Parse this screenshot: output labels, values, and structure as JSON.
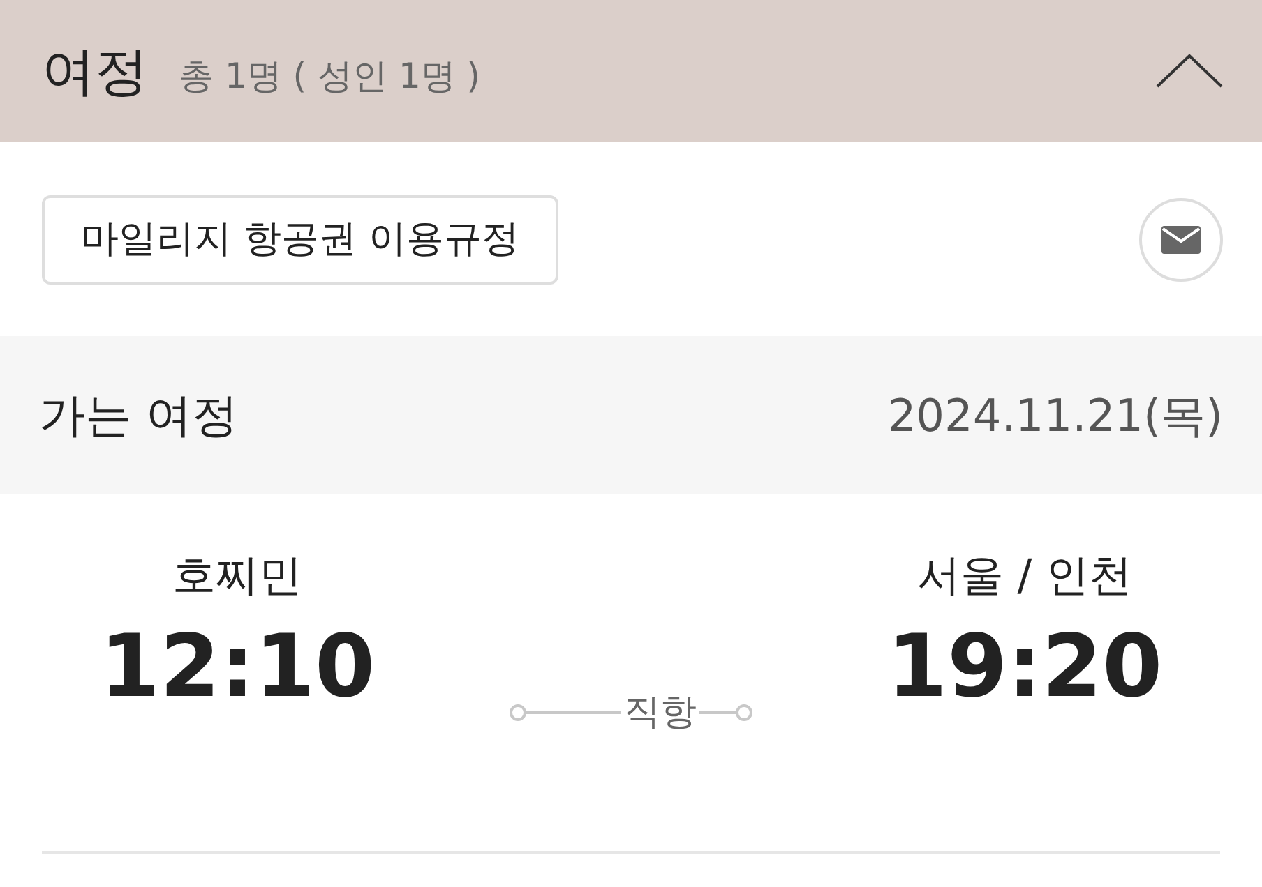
{
  "header": {
    "title": "여정",
    "summary": "총 1명 ( 성인 1명 )",
    "expanded": true
  },
  "toolbar": {
    "rules_button": "마일리지 항공권 이용규정"
  },
  "segment": {
    "title": "가는 여정",
    "date": "2024.11.21(목)"
  },
  "flight": {
    "origin": {
      "city": "호찌민",
      "time": "12:10"
    },
    "destination": {
      "city": "서울 / 인천",
      "time": "19:20"
    },
    "route_type": "직항"
  }
}
